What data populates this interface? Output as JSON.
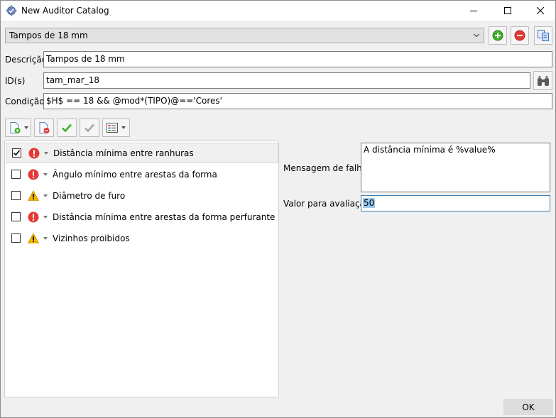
{
  "window": {
    "title": "New Auditor Catalog",
    "icon": "gear-check-icon"
  },
  "catalog": {
    "selected": "Tampos de 18 mm"
  },
  "form": {
    "descricao_label": "Descrição",
    "descricao_value": "Tampos de 18 mm",
    "ids_label": "ID(s)",
    "ids_value": "tam_mar_18",
    "condicao_label": "Condição",
    "condicao_value": "$H$ == 18 && @mod*(TIPO)@=='Cores'"
  },
  "rules": [
    {
      "label": "Distância mínima entre ranhuras",
      "checked": true,
      "status": "error"
    },
    {
      "label": "Ângulo mínimo entre arestas da forma",
      "checked": false,
      "status": "error"
    },
    {
      "label": "Diâmetro de furo",
      "checked": false,
      "status": "warning"
    },
    {
      "label": "Distância mínima entre arestas da forma perfurante",
      "checked": false,
      "status": "error"
    },
    {
      "label": "Vizinhos proibidos",
      "checked": false,
      "status": "warning"
    }
  ],
  "details": {
    "failure_message_label": "Mensagem de falha",
    "failure_message_value": "A distância mínima é %value%",
    "eval_value_label": "Valor para avaliação",
    "eval_value": "50"
  },
  "footer": {
    "ok_label": "OK"
  },
  "colors": {
    "error": "#e53935",
    "warning": "#f5b400",
    "add_green": "#3fae29",
    "remove_red": "#e53935",
    "selection": "#99c9ef"
  }
}
